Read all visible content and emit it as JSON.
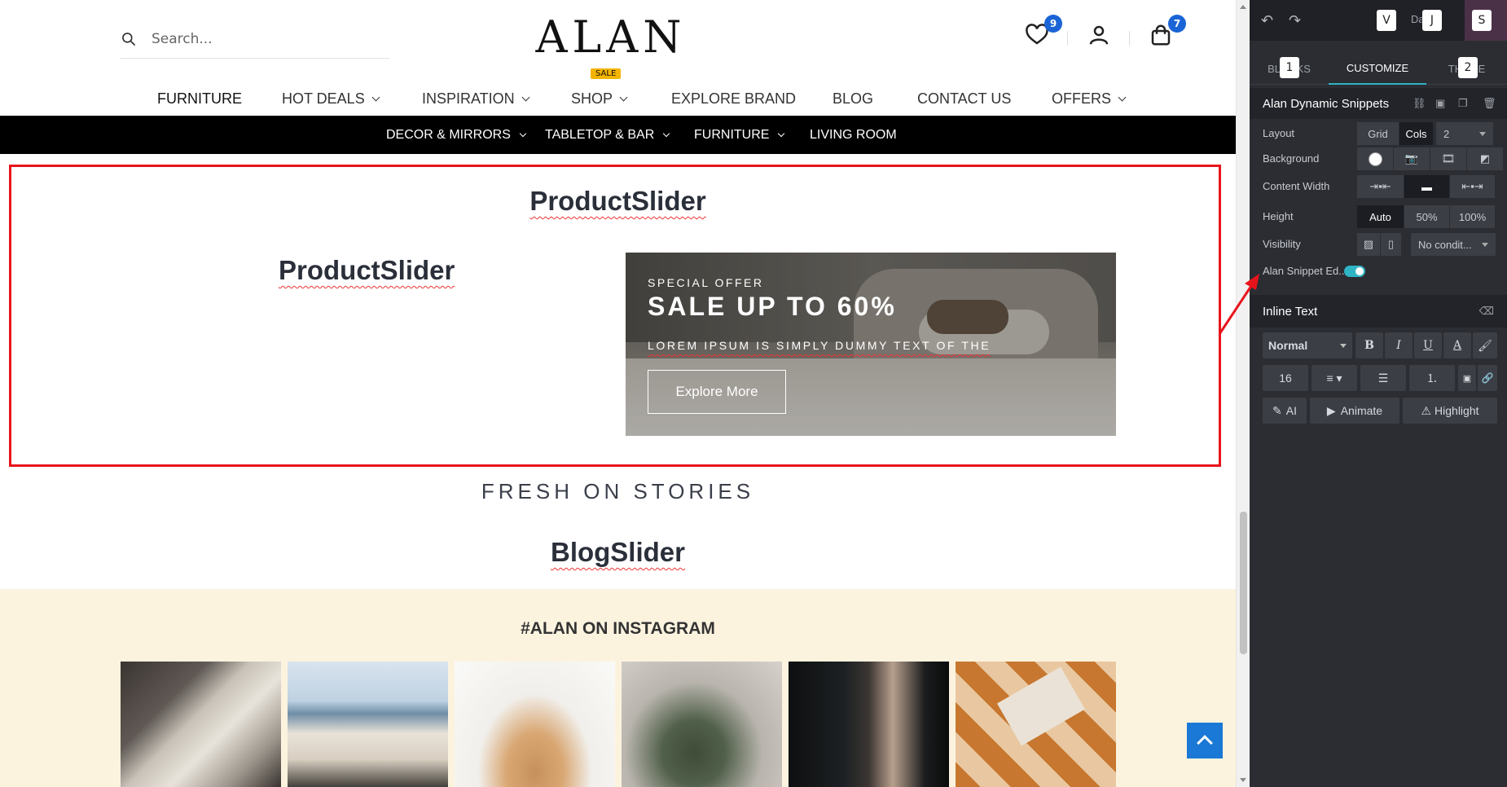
{
  "site": {
    "search": {
      "placeholder": "Search..."
    },
    "logo": "ALAN",
    "wishlist_count": "9",
    "cart_count": "7",
    "main_nav": [
      {
        "label": "FURNITURE",
        "has_menu": false
      },
      {
        "label": "HOT DEALS",
        "has_menu": true
      },
      {
        "label": "INSPIRATION",
        "has_menu": true
      },
      {
        "label": "SHOP",
        "has_menu": true,
        "badge": "SALE"
      },
      {
        "label": "EXPLORE BRAND",
        "has_menu": false
      },
      {
        "label": "BLOG",
        "has_menu": false
      },
      {
        "label": "CONTACT US",
        "has_menu": false
      },
      {
        "label": "OFFERS",
        "has_menu": true
      }
    ],
    "sub_nav": [
      {
        "label": "DECOR & MIRRORS",
        "has_menu": true
      },
      {
        "label": "TABLETOP & BAR",
        "has_menu": true
      },
      {
        "label": "FURNITURE",
        "has_menu": true
      },
      {
        "label": "LIVING ROOM",
        "has_menu": false
      }
    ],
    "product_slider_heading": "ProductSlider",
    "product_slider_inner": "ProductSlider",
    "banner": {
      "eyebrow": "SPECIAL OFFER",
      "title": "SALE UP TO 60%",
      "description": "LOREM IPSUM IS SIMPLY DUMMY TEXT OF THE",
      "button": "Explore More"
    },
    "stories_heading": "FRESH ON STORIES",
    "blog_slider_heading": "BlogSlider",
    "instagram_heading": "#ALAN ON INSTAGRAM"
  },
  "panel": {
    "top_keys": [
      "V",
      "J",
      "S"
    ],
    "top_ghost_text": "Dard",
    "tab_keys": [
      "1",
      "2"
    ],
    "tabs": [
      "BLOCKS",
      "CUSTOMIZE",
      "THEME"
    ],
    "snippet_name": "Alan Dynamic Snippets",
    "layout": {
      "label": "Layout",
      "options": [
        "Grid",
        "Cols"
      ],
      "selected": "Cols",
      "cols_value": "2"
    },
    "background": {
      "label": "Background"
    },
    "content_width": {
      "label": "Content Width"
    },
    "height": {
      "label": "Height",
      "options": [
        "Auto",
        "50%",
        "100%"
      ],
      "selected": "Auto"
    },
    "visibility": {
      "label": "Visibility",
      "value": "No condit..."
    },
    "snippet_editor": {
      "label": "Alan Snippet Ed...",
      "enabled": true
    },
    "inline_text": {
      "title": "Inline Text",
      "style": "Normal",
      "font_size": "16",
      "bold": "B",
      "italic": "I",
      "underline": "U",
      "text_color": "A",
      "ai": "AI",
      "animate": "Animate",
      "highlight": "Highlight"
    }
  },
  "colors": {
    "accent_teal": "#2fb4c4",
    "badge_blue": "#1a64d6",
    "highlight_red": "#e8141b",
    "panel_bg": "#2b2d33"
  }
}
